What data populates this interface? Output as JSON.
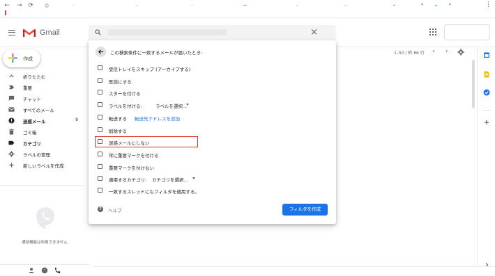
{
  "gmail": {
    "wordmark": "Gmail"
  },
  "sidebar": {
    "compose_label": "作成",
    "items": [
      {
        "label": "折りたたむ",
        "icon": "chevron-up-icon"
      },
      {
        "label": "重要",
        "icon": "important-icon"
      },
      {
        "label": "チャット",
        "icon": "chat-icon"
      },
      {
        "label": "すべてのメール",
        "icon": "all-mail-icon"
      },
      {
        "label": "迷惑メール",
        "icon": "spam-icon",
        "count": "9",
        "bold": true
      },
      {
        "label": "ゴミ箱",
        "icon": "trash-icon"
      },
      {
        "label": "カテゴリ",
        "icon": "label-icon",
        "bold": true
      },
      {
        "label": "ラベルの管理",
        "icon": "gear-icon"
      },
      {
        "label": "新しいラベルを作成",
        "icon": "plus-icon"
      }
    ],
    "hangouts_text": "通話機能は利用できません"
  },
  "list": {
    "pager": "1–50 / 約 86 行"
  },
  "filter_popup": {
    "title": "この検索条件に一致するメールが届いたとき:",
    "options": [
      {
        "label": "受信トレイをスキップ (アーカイブする)"
      },
      {
        "label": "既読にする"
      },
      {
        "label": "スターを付ける"
      },
      {
        "label": "ラベルを付ける:",
        "select": "ラベルを選択..."
      },
      {
        "label": "転送する",
        "link": "転送先アドレスを追加"
      },
      {
        "label": "削除する"
      },
      {
        "label": "迷惑メールにしない"
      },
      {
        "label": "常に重要マークを付ける"
      },
      {
        "label": "重要マークを付けない"
      },
      {
        "label": "適用するカテゴリ:",
        "select": "カテゴリを選択..."
      },
      {
        "label": "一致するスレッドにもフィルタを適用する。"
      }
    ],
    "help_label": "ヘルプ",
    "create_button": "フィルタを作成"
  },
  "colors": {
    "accent": "#1a73e8",
    "highlight": "#d93025",
    "gmail_red": "#ea4335"
  }
}
